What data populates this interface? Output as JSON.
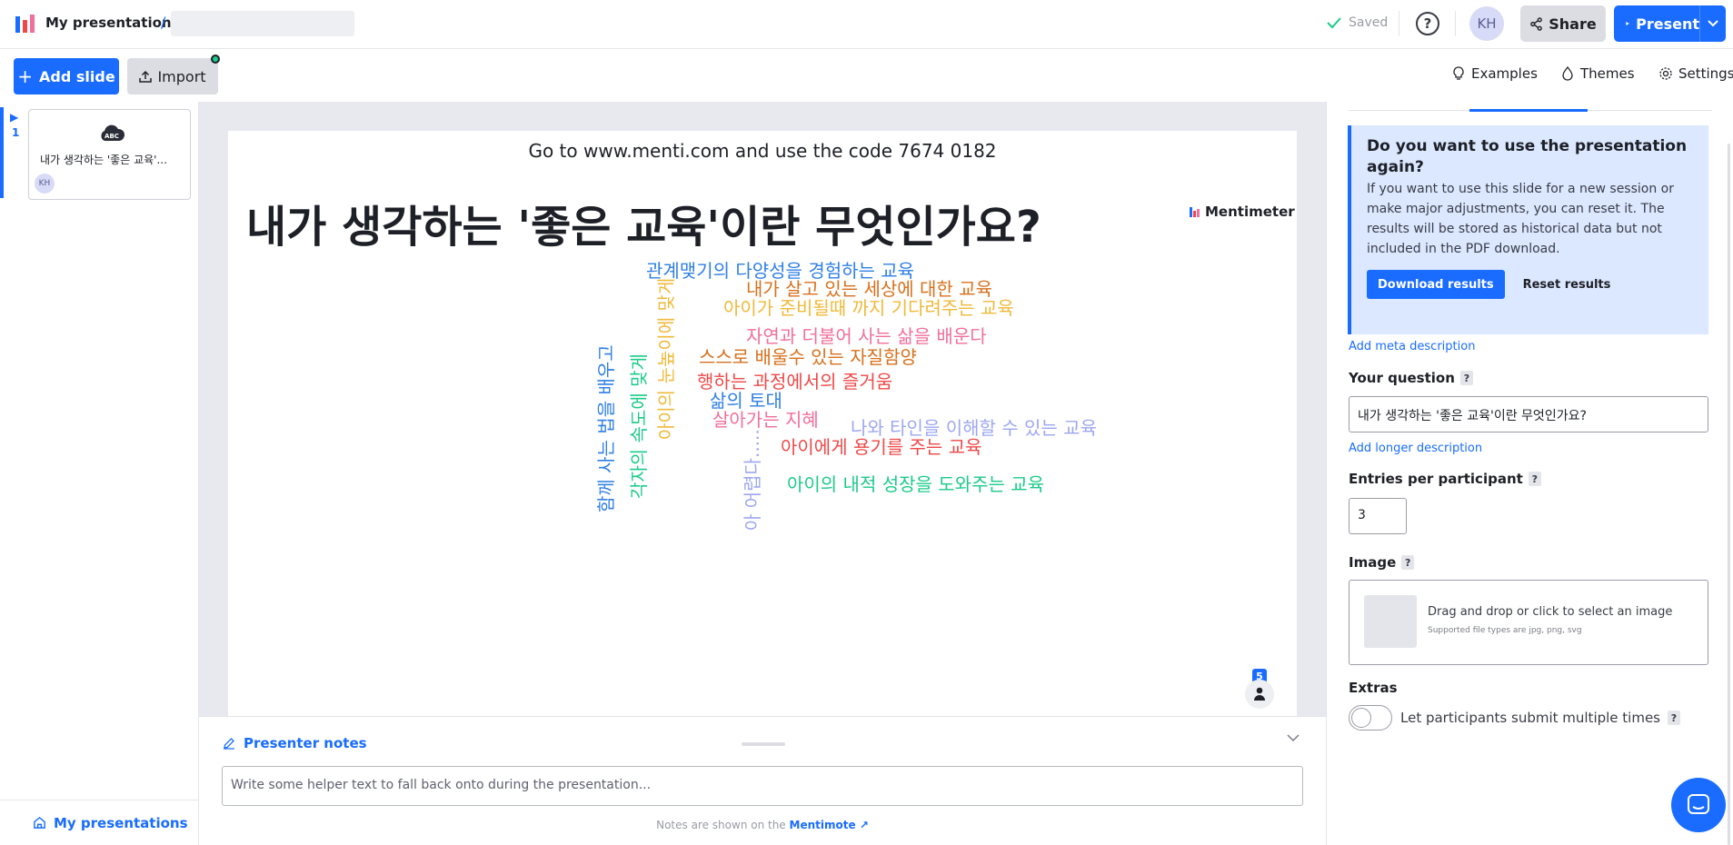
{
  "header": {
    "breadcrumb": "My presentations",
    "slash": "/",
    "saved": "Saved",
    "help": "?",
    "avatar_initials": "KH",
    "share_label": "Share",
    "present_label": "Present"
  },
  "toolbar": {
    "add_slide": "Add slide",
    "import": "Import",
    "examples": "Examples",
    "themes": "Themes",
    "settings": "Settings"
  },
  "rail": {
    "slide_number": "1",
    "thumb_badge": "ABC",
    "thumb_title": "내가 생각하는 '좋은 교육'...",
    "thumb_avatar": "KH",
    "my_presentations": "My presentations"
  },
  "slide": {
    "join_text": "Go to www.menti.com and use the code 7674 0182",
    "question": "내가 생각하는 '좋은 교육'이란 무엇인가요?",
    "brand": "Mentimeter",
    "response_count": "5",
    "words": [
      {
        "text": "관계맺기의 다양성을 경험하는 교육",
        "color": "#2f7fe6"
      },
      {
        "text": "내가 살고 있는 세상에 대한 교육",
        "color": "#d7701c"
      },
      {
        "text": "아이가 준비될때 까지 기다려주는 교육",
        "color": "#f0b93a"
      },
      {
        "text": "자연과 더불어 사는 삶을 배운다",
        "color": "#f06f9b"
      },
      {
        "text": "스스로 배울수 있는 자질함양",
        "color": "#d7701c"
      },
      {
        "text": "행하는 과정에서의 즐거움",
        "color": "#ef4848"
      },
      {
        "text": "삶의 토대",
        "color": "#2f7fe6"
      },
      {
        "text": "살아가는 지혜",
        "color": "#f06f9b"
      },
      {
        "text": "나와 타인을 이해할 수 있는 교육",
        "color": "#9da7f0"
      },
      {
        "text": "아이에게 용기를 주는 교육",
        "color": "#ef4848"
      },
      {
        "text": "아이의 내적 성장을 도와주는 교육",
        "color": "#1ccb8a"
      },
      {
        "text": "아이의 눈높이에 맞게",
        "color": "#f0b93a"
      },
      {
        "text": "함께 사는 법을 배우고",
        "color": "#2f7fe6"
      },
      {
        "text": "각자의 속도에 맞게",
        "color": "#1ccb8a"
      },
      {
        "text": "아 어렵다.....",
        "color": "#9da7f0"
      }
    ]
  },
  "notes": {
    "heading": "Presenter notes",
    "placeholder": "Write some helper text to fall back onto during the presentation...",
    "footer_text": "Notes are shown on the",
    "footer_link": "Mentimote"
  },
  "panel": {
    "reset_title": "Do you want to use the presentation again?",
    "reset_body": "If you want to use this slide for a new session or make major adjustments, you can reset it. The results will be stored as historical data but not included in the PDF download.",
    "download_results": "Download results",
    "reset_results": "Reset results",
    "add_meta": "Add meta description",
    "your_question": "Your question",
    "question_value": "내가 생각하는 '좋은 교육'이란 무엇인가요?",
    "add_longer": "Add longer description",
    "entries_label": "Entries per participant",
    "entries_value": "3",
    "image_label": "Image",
    "drop_text": "Drag and drop or click to select an image",
    "drop_hint": "Supported file types are jpg, png, svg",
    "extras_label": "Extras",
    "multiple_label": "Let participants submit multiple times",
    "help": "?"
  },
  "colors": {
    "accent": "#196cff",
    "reset_box": "#dbe8ff"
  }
}
